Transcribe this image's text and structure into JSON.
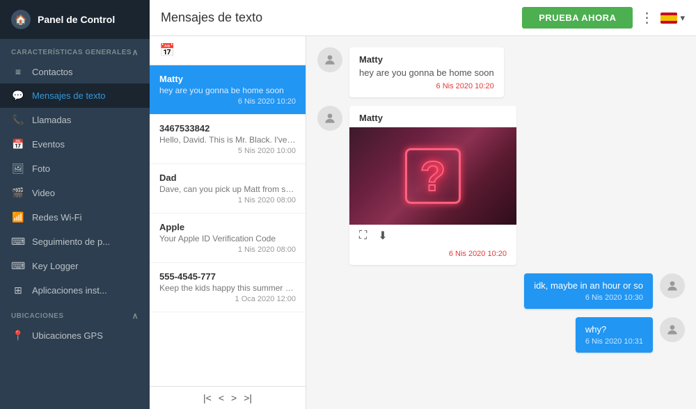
{
  "sidebar": {
    "header": {
      "title": "Panel de Control",
      "icon": "🏠"
    },
    "sections": [
      {
        "label": "CARACTERÍSTICAS GENERALES",
        "items": [
          {
            "id": "contactos",
            "label": "Contactos",
            "icon": "☰"
          },
          {
            "id": "mensajes",
            "label": "Mensajes de texto",
            "icon": "💬",
            "active": true
          },
          {
            "id": "llamadas",
            "label": "Llamadas",
            "icon": "📞"
          },
          {
            "id": "eventos",
            "label": "Eventos",
            "icon": "📅"
          },
          {
            "id": "foto",
            "label": "Foto",
            "icon": "🖼"
          },
          {
            "id": "video",
            "label": "Video",
            "icon": "🎬"
          },
          {
            "id": "redes",
            "label": "Redes Wi-Fi",
            "icon": "📶"
          },
          {
            "id": "seguimiento",
            "label": "Seguimiento de p...",
            "icon": "⌨"
          },
          {
            "id": "keylogger",
            "label": "Key Logger",
            "icon": "⌨"
          },
          {
            "id": "apps",
            "label": "Aplicaciones inst...",
            "icon": "⊞"
          }
        ]
      },
      {
        "label": "UBICACIONES",
        "items": [
          {
            "id": "gps",
            "label": "Ubicaciones GPS",
            "icon": "📍"
          }
        ]
      }
    ]
  },
  "topbar": {
    "title": "Mensajes de texto",
    "prueba_label": "PRUEBA AHORA",
    "more_icon": "⋮"
  },
  "msg_list": {
    "items": [
      {
        "id": "matty",
        "name": "Matty",
        "preview": "hey are you gonna be home soon",
        "time": "6 Nis 2020 10:20",
        "selected": true
      },
      {
        "id": "3467533842",
        "name": "3467533842",
        "preview": "Hello, David. This is Mr. Black. I've noti...",
        "time": "5 Nis 2020 10:00",
        "selected": false
      },
      {
        "id": "dad",
        "name": "Dad",
        "preview": "Dave, can you pick up Matt from schoo...",
        "time": "1 Nis 2020 08:00",
        "selected": false
      },
      {
        "id": "apple",
        "name": "Apple",
        "preview": "Your Apple ID Verification Code",
        "time": "1 Nis 2020 08:00",
        "selected": false
      },
      {
        "id": "555-4545-777",
        "name": "555-4545-777",
        "preview": "Keep the kids happy this summer with ...",
        "time": "1 Oca 2020 12:00",
        "selected": false
      }
    ],
    "pagination": {
      "first": "|<",
      "prev": "<",
      "next": ">",
      "last": ">|"
    }
  },
  "conversation": {
    "messages": [
      {
        "type": "incoming-text",
        "sender": "Matty",
        "text": "hey are you gonna be home soon",
        "time": "6 Nis 2020 10:20"
      },
      {
        "type": "incoming-image",
        "sender": "Matty",
        "time": "6 Nis 2020 10:20"
      },
      {
        "type": "outgoing",
        "text": "idk, maybe in an hour or so",
        "time": "6 Nis 2020 10:30"
      },
      {
        "type": "outgoing",
        "text": "why?",
        "time": "6 Nis 2020 10:31"
      }
    ]
  }
}
